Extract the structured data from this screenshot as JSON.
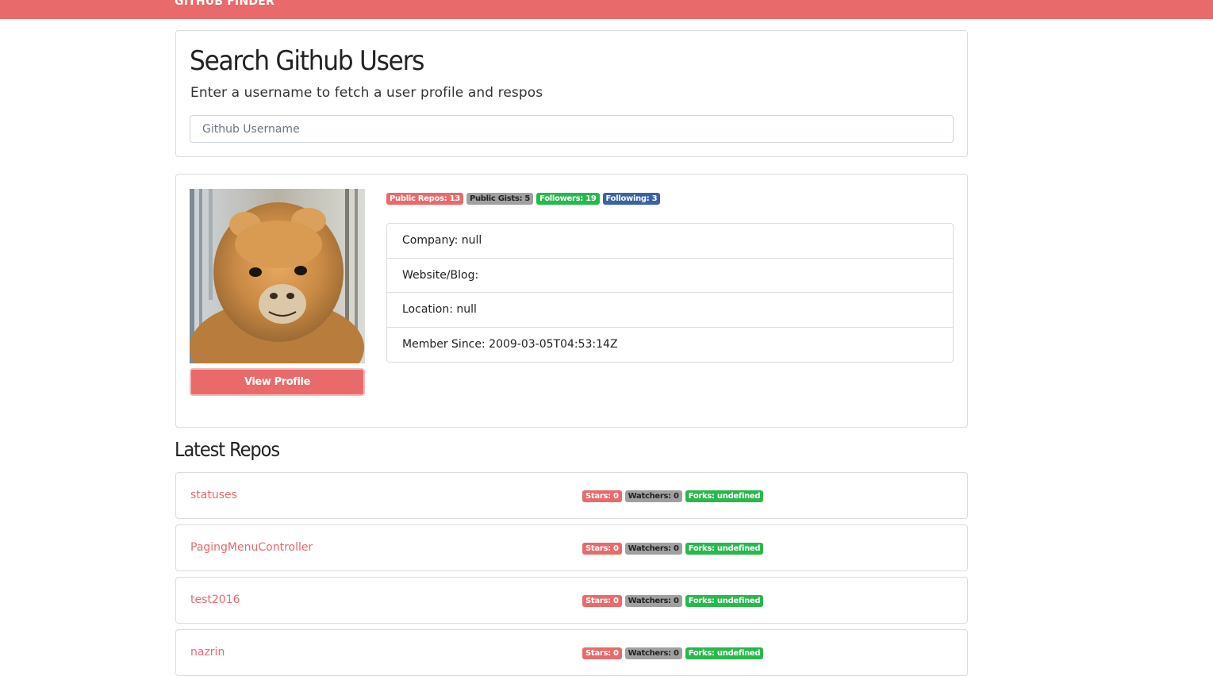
{
  "navbar": {
    "brand": "GITHUB FINDER"
  },
  "search": {
    "title": "Search Github Users",
    "subtitle": "Enter a username to fetch a user profile and respos",
    "placeholder": "Github Username",
    "value": ""
  },
  "profile": {
    "avatar_icon": "alpaca-avatar-image",
    "view_profile_label": "View Profile",
    "badges": {
      "public_repos": "Public Repos: 13",
      "public_gists": "Public Gists: 5",
      "followers": "Followers: 19",
      "following": "Following: 3"
    },
    "info": {
      "company": "Company: null",
      "website": "Website/Blog:",
      "location": "Location: null",
      "member_since": "Member Since: 2009-03-05T04:53:14Z"
    }
  },
  "repos": {
    "heading": "Latest Repos",
    "items": [
      {
        "name": "statuses",
        "stars": "Stars: 0",
        "watchers": "Watchers: 0",
        "forks": "Forks: undefined"
      },
      {
        "name": "PagingMenuController",
        "stars": "Stars: 0",
        "watchers": "Watchers: 0",
        "forks": "Forks: undefined"
      },
      {
        "name": "test2016",
        "stars": "Stars: 0",
        "watchers": "Watchers: 0",
        "forks": "Forks: undefined"
      },
      {
        "name": "nazrin",
        "stars": "Stars: 0",
        "watchers": "Watchers: 0",
        "forks": "Forks: undefined"
      }
    ]
  },
  "colors": {
    "accent": "#e86a6a",
    "badge_gray": "#a0a0a0",
    "badge_green": "#28b84c",
    "badge_blue": "#3a63a6"
  }
}
